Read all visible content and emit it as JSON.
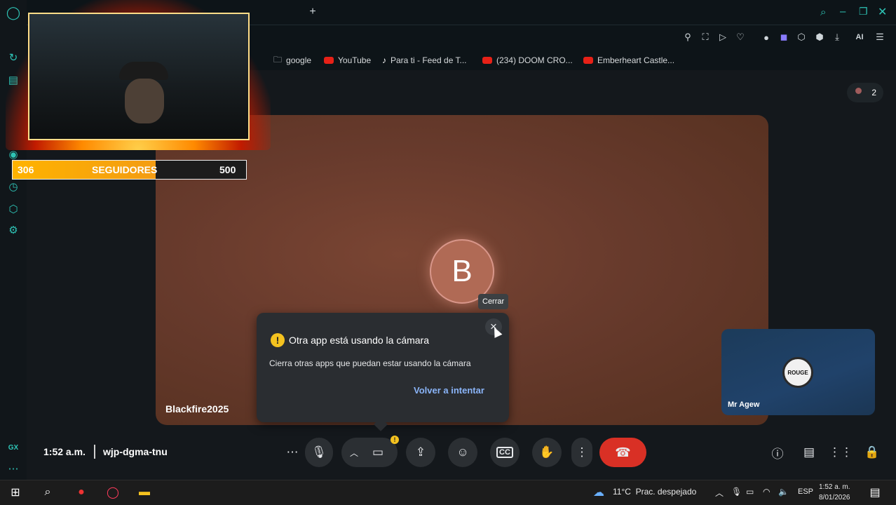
{
  "browser": {
    "bookmarks": [
      {
        "label": "google",
        "icon": "folder-icon"
      },
      {
        "label": "YouTube",
        "icon": "youtube-icon"
      },
      {
        "label": "Para ti - Feed de T...",
        "icon": "tiktok-icon"
      },
      {
        "label": "(234) DOOM CRO...",
        "icon": "youtube-icon"
      },
      {
        "label": "Emberheart Castle...",
        "icon": "youtube-icon"
      }
    ],
    "new_tab_label": "+",
    "ai_label": "AI"
  },
  "meet": {
    "participant_count": "2",
    "main_tile": {
      "initial": "B",
      "name": "Blackfire2025"
    },
    "side_tile": {
      "name": "Mr Agew",
      "logo_text": "ROUGE"
    },
    "dialog": {
      "title": "Otra app está usando la cámara",
      "body": "Cierra otras apps que puedan estar usando la cámara",
      "retry_label": "Volver a intentar",
      "close_tooltip": "Cerrar"
    },
    "time": "1:52 a.m.",
    "meeting_code": "wjp-dgma-tnu",
    "end_call_color": "#d93025"
  },
  "overlay": {
    "followers_current": "306",
    "followers_label": "SEGUIDORES",
    "followers_goal": "500",
    "progress_fraction": 0.612
  },
  "taskbar": {
    "weather_temp": "11°C",
    "weather_desc": "Prac. despejado",
    "language": "ESP",
    "clock_time": "1:52 a. m.",
    "clock_date": "8/01/2026"
  }
}
